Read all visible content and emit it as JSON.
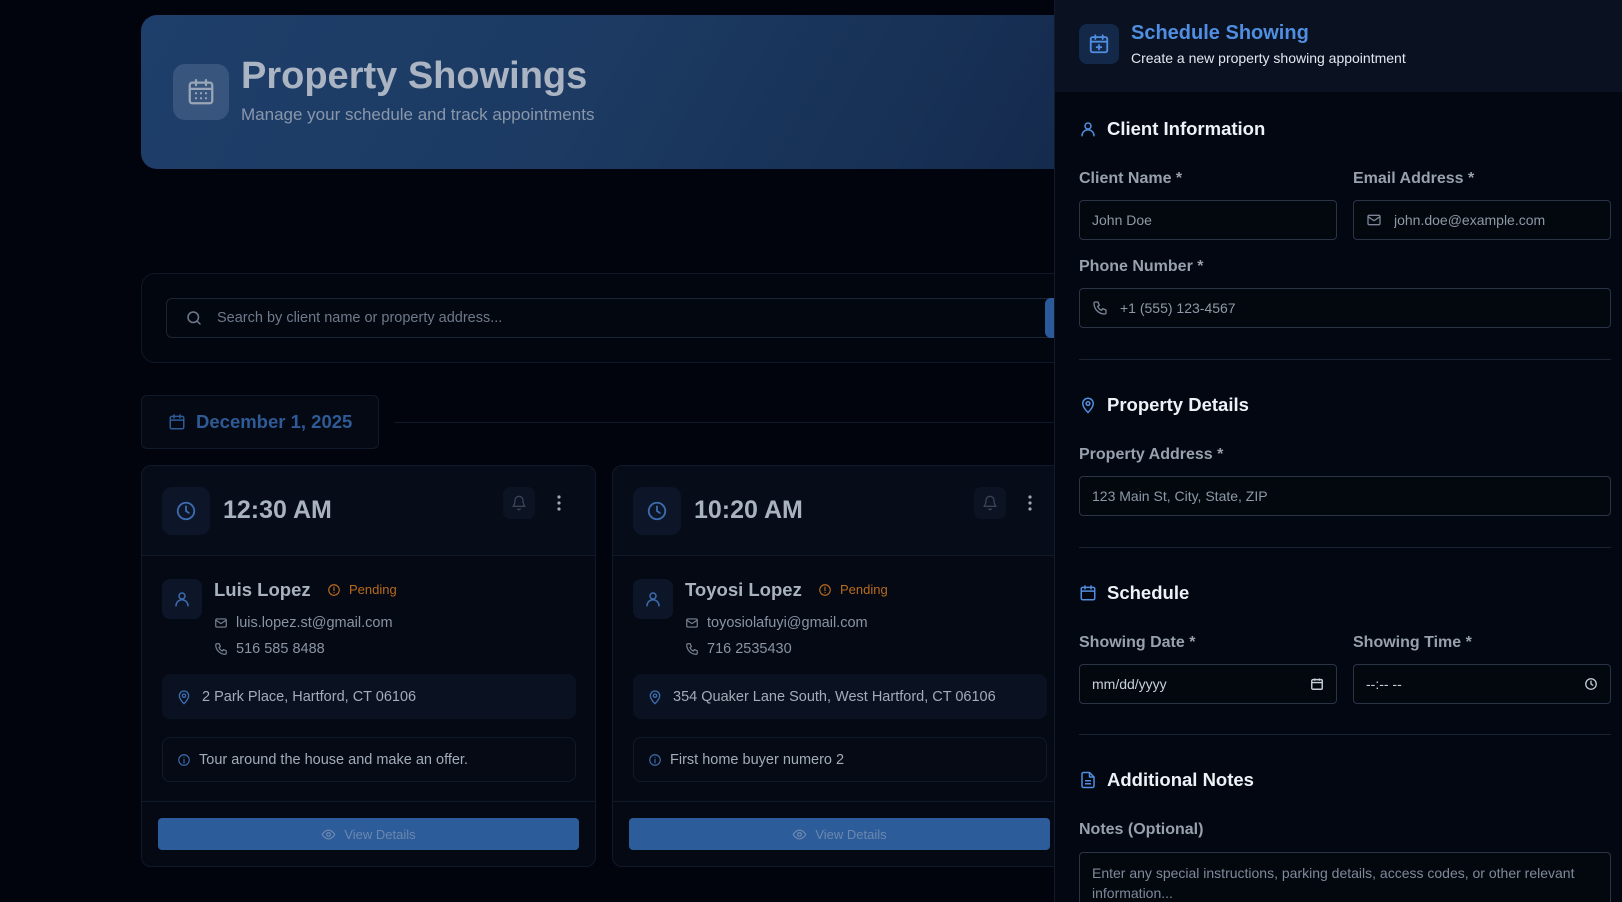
{
  "page": {
    "header": {
      "title": "Property Showings",
      "subtitle": "Manage your schedule and track appointments",
      "icon": "calendar-icon"
    },
    "search": {
      "placeholder": "Search by client name or property address..."
    },
    "date_group": {
      "label": "December 1, 2025"
    },
    "showings": [
      {
        "time": "12:30 AM",
        "client_name": "Luis Lopez",
        "status": "Pending",
        "email": "luis.lopez.st@gmail.com",
        "phone": "516 585 8488",
        "address": "2 Park Place, Hartford, CT 06106",
        "note": "Tour around the house and make an offer.",
        "button_label": "View Details"
      },
      {
        "time": "10:20 AM",
        "client_name": "Toyosi Lopez",
        "status": "Pending",
        "email": "toyosiolafuyi@gmail.com",
        "phone": "716 2535430",
        "address": "354 Quaker Lane South, West Hartford, CT 06106",
        "note": "First home buyer numero 2",
        "button_label": "View Details"
      }
    ]
  },
  "drawer": {
    "title": "Schedule Showing",
    "subtitle": "Create a new property showing appointment",
    "sections": {
      "client": {
        "title": "Client Information",
        "name_label": "Client Name *",
        "name_placeholder": "John Doe",
        "email_label": "Email Address *",
        "email_placeholder": "john.doe@example.com",
        "phone_label": "Phone Number *",
        "phone_placeholder": "+1 (555) 123-4567"
      },
      "property": {
        "title": "Property Details",
        "address_label": "Property Address *",
        "address_placeholder": "123 Main St, City, State, ZIP"
      },
      "schedule": {
        "title": "Schedule",
        "date_label": "Showing Date *",
        "date_value": "mm/dd/yyyy",
        "time_label": "Showing Time *",
        "time_value": "--:-- --"
      },
      "notes": {
        "title": "Additional Notes",
        "label": "Notes (Optional)",
        "placeholder": "Enter any special instructions, parking details, access codes, or other relevant information..."
      }
    }
  },
  "colors": {
    "accent": "#4f8ee0",
    "pending": "#b86a1f",
    "background": "#01040c",
    "button": "#2c5c99"
  }
}
